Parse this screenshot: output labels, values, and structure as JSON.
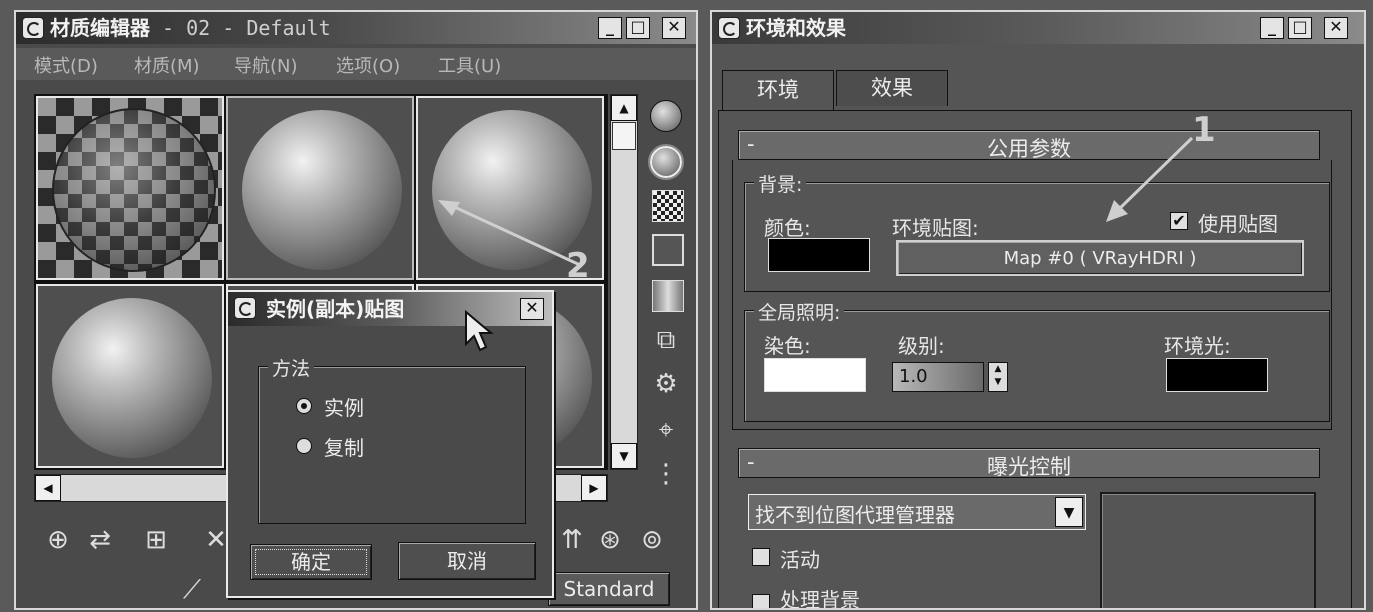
{
  "material_editor": {
    "title": "材质编辑器",
    "title_suffix": " - 02 - Default",
    "buttons": {
      "minimize": "_",
      "maximize": "□",
      "close": "✕"
    },
    "menus": [
      "模式(D)",
      "材质(M)",
      "导航(N)",
      "选项(O)",
      "工具(U)"
    ],
    "scroll_up": "▲",
    "scroll_down": "▼",
    "scroll_left": "◀",
    "scroll_right": "▶",
    "material_type_button": "Standard"
  },
  "instance_dialog": {
    "title": "实例(副本)贴图",
    "close": "✕",
    "group_label": "方法",
    "options": [
      {
        "label": "实例",
        "selected": true
      },
      {
        "label": "复制",
        "selected": false
      }
    ],
    "ok_label": "确定",
    "cancel_label": "取消"
  },
  "env_effects": {
    "title": "环境和效果",
    "buttons": {
      "minimize": "_",
      "maximize": "□",
      "close": "✕"
    },
    "tabs": [
      {
        "label": "环境",
        "active": true
      },
      {
        "label": "效果",
        "active": false
      }
    ],
    "common_params": {
      "collapse": "-",
      "title": "公用参数",
      "background_group": "背景:",
      "color_label": "颜色:",
      "env_map_label": "环境贴图:",
      "use_map_label": "使用贴图",
      "use_map_checked": true,
      "map_button": "Map #0  ( VRayHDRI )",
      "bg_color": "#000000",
      "gi_group": "全局照明:",
      "tint_label": "染色:",
      "tint_color": "#ffffff",
      "level_label": "级别:",
      "level_value": "1.0",
      "ambient_label": "环境光:",
      "ambient_color": "#000000"
    },
    "exposure": {
      "collapse": "-",
      "title": "曝光控制",
      "dropdown_value": "找不到位图代理管理器",
      "dropdown_arrow": "▼",
      "active_label": "活动",
      "process_bg_label": "处理背景"
    }
  },
  "annotations": [
    "1",
    "2"
  ]
}
